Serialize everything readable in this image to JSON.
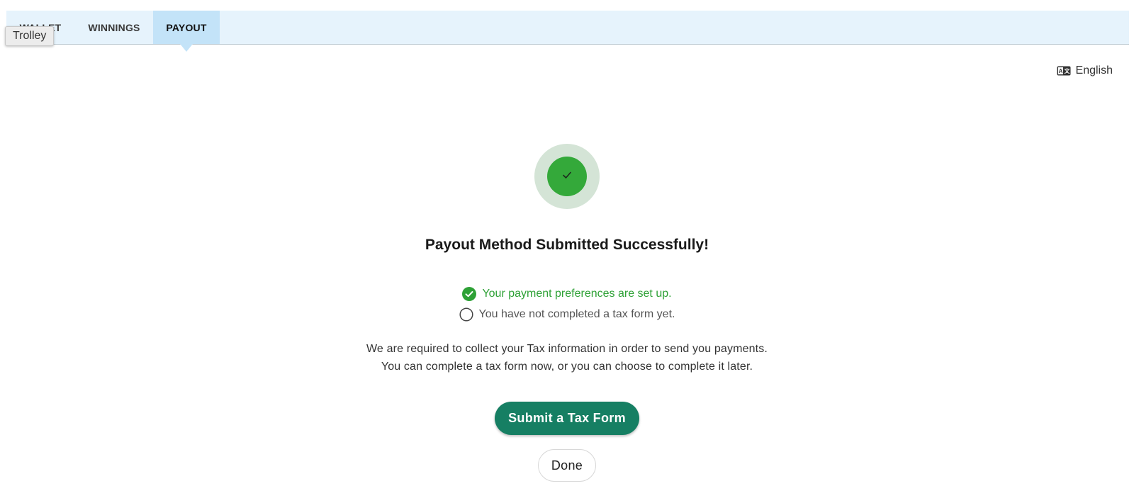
{
  "tabs": {
    "wallet": "WALLET",
    "winnings": "WINNINGS",
    "payout": "PAYOUT"
  },
  "tooltip": "Trolley",
  "language": {
    "label": "English",
    "icon": "language-icon"
  },
  "badge": {
    "icon": "checkmark-icon",
    "color": "#34a93a"
  },
  "title": "Payout Method Submitted Successfully!",
  "status": {
    "payment_set": "Your payment preferences are set up.",
    "tax_pending": "You have not completed a tax form yet."
  },
  "info": {
    "line1": "We are required to collect your Tax information in order to send you payments.",
    "line2": "You can complete a tax form now, or you can choose to complete it later."
  },
  "buttons": {
    "submit_tax": "Submit a Tax Form",
    "done": "Done"
  },
  "colors": {
    "accent": "#167f63",
    "success": "#2ea136",
    "tab_bar": "#e6f3fc",
    "tab_active": "#c3e3f8"
  }
}
